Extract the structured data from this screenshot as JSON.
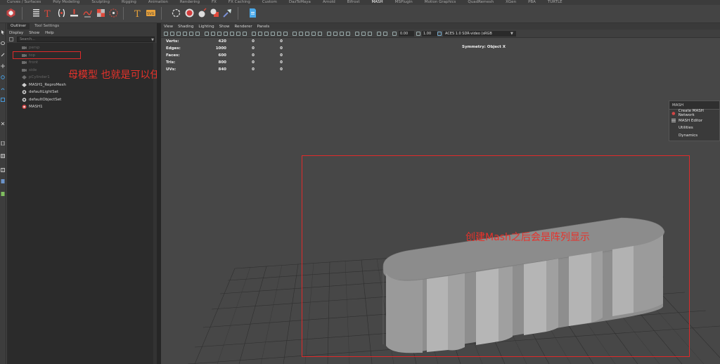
{
  "shelf_tabs": [
    "Curves / Surfaces",
    "Poly Modeling",
    "Sculpting",
    "Rigging",
    "Animation",
    "Rendering",
    "FX",
    "FX Caching",
    "Custom",
    "DazToMaya",
    "Arnold",
    "Bifrost",
    "MASH",
    "MSPlugin",
    "Motion Graphics",
    "QuadRemesh",
    "XGen",
    "PBA",
    "TURTLE"
  ],
  "shelf_active_tab": "MASH",
  "outliner": {
    "tabs": [
      "Outliner",
      "Tool Settings"
    ],
    "menu": [
      "Display",
      "Show",
      "Help"
    ],
    "search_placeholder": "Search...",
    "items": [
      {
        "label": "persp",
        "icon": "camera-icon"
      },
      {
        "label": "top",
        "icon": "camera-icon"
      },
      {
        "label": "front",
        "icon": "camera-icon"
      },
      {
        "label": "side",
        "icon": "camera-icon"
      },
      {
        "label": "pCylinder1",
        "icon": "mesh-icon"
      },
      {
        "label": "MASH1_ReproMesh",
        "icon": "mesh-icon"
      },
      {
        "label": "defaultLightSet",
        "icon": "set-icon"
      },
      {
        "label": "defaultObjectSet",
        "icon": "set-icon"
      },
      {
        "label": "MASH1",
        "icon": "mash-network-icon"
      }
    ]
  },
  "annotations": {
    "parent_model_note": "母模型 也就是可以任意改的模型在这",
    "mash_array_note": "创建Mash之后会是阵列显示"
  },
  "viewport": {
    "menu": [
      "View",
      "Shading",
      "Lighting",
      "Show",
      "Renderer",
      "Panels"
    ],
    "exposure": "0.00",
    "gamma": "1.00",
    "color_space": "ACES 1.0 SDR-video (sRGB",
    "hud": [
      {
        "label": "Verts:",
        "total": "420",
        "sel": "0",
        "tri": "0"
      },
      {
        "label": "Edges:",
        "total": "1000",
        "sel": "0",
        "tri": "0"
      },
      {
        "label": "Faces:",
        "total": "600",
        "sel": "0",
        "tri": "0"
      },
      {
        "label": "Tris:",
        "total": "800",
        "sel": "0",
        "tri": "0"
      },
      {
        "label": "UVs:",
        "total": "840",
        "sel": "0",
        "tri": "0"
      }
    ],
    "symmetry": "Symmetry: Object X"
  },
  "mash_menu": {
    "title": "MASH",
    "items": [
      "Create MASH Network",
      "MASH Editor",
      "Utilities",
      "Dynamics"
    ]
  },
  "colors": {
    "annotation_red": "#e8322b",
    "viewport_bg": "#474747",
    "outliner_bg": "#2b2b2b"
  }
}
